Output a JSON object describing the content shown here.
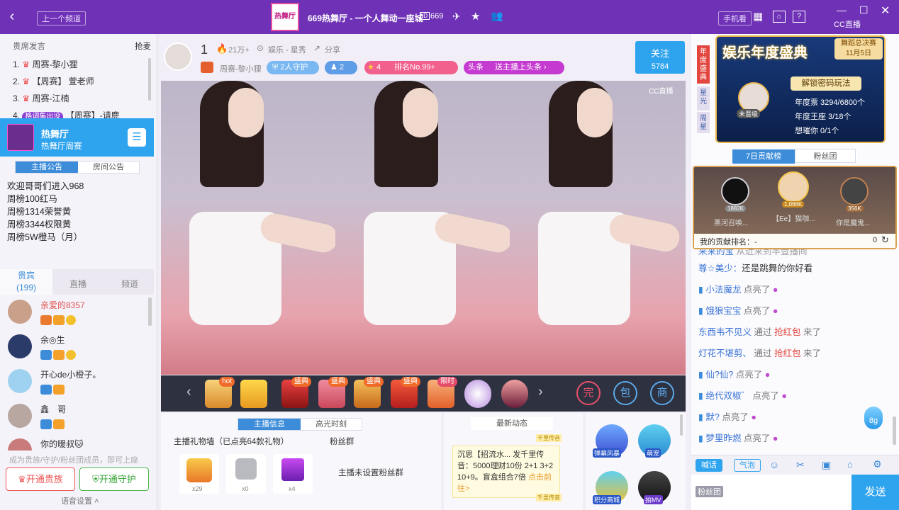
{
  "topbar": {
    "prev_channel": "上一个频道",
    "room_title": "669热舞厅 - 一个人舞动一座城",
    "room_id": "669",
    "phone_btn": "手机看",
    "help": "?",
    "cc_logo": "CC直播",
    "logo_text": "热舞厅"
  },
  "left": {
    "ranking_title": "贵席发言",
    "grab": "抢麦",
    "ranks": [
      {
        "num": "1.",
        "name": "周赛-黎小狸"
      },
      {
        "num": "2.",
        "name": "【周赛】 萱老师"
      },
      {
        "num": "3.",
        "name": "周赛-江楠"
      },
      {
        "num": "4.",
        "name": "【周赛】-请麂",
        "tag": "格调集出没"
      }
    ],
    "channel": {
      "name": "热舞厅",
      "sub": "热舞厅周赛"
    },
    "notice_tabs": [
      "主播公告",
      "房间公告"
    ],
    "notice_lines": [
      "欢迎哥哥们进入968",
      "周榜100红马",
      "周榜1314荣誉黄",
      "周榜3344权限黄",
      "周榜5W橙马（月）"
    ],
    "user_tabs": {
      "vip": "贵宾",
      "vip_count": "(199)",
      "live": "直播",
      "channel": "频道"
    },
    "users": [
      {
        "name": "亲爱的8357",
        "color": "#e0534f"
      },
      {
        "name": "余◎生",
        "color": "#333"
      },
      {
        "name": "开心de小橙子。",
        "color": "#333"
      },
      {
        "name": "鑫　哥",
        "color": "#333"
      },
      {
        "name": "你的暖叔🐱",
        "color": "#333"
      }
    ],
    "upgrade_hint": "成为贵族/守护/粉丝团成员，即可上座",
    "btn_noble": "开通贵族",
    "btn_guard": "开通守护",
    "voice_settings": "语音设置"
  },
  "anchor": {
    "level": "1",
    "heat": "21万+",
    "category": "娱乐 - 星秀",
    "share": "分享",
    "nick": "周赛-黎小狸",
    "guard": "2人守护",
    "fans": "2",
    "stars": "4",
    "rank": "排名No.99+",
    "headline": "头条",
    "headline_link": "送主播上头条",
    "follow": "关注",
    "follow_count": "5784",
    "watermark": "CC直播"
  },
  "gifts": {
    "labels": [
      "hot",
      "盛典",
      "盛典",
      "盛典",
      "盛典",
      "盛典",
      "限时"
    ],
    "ops": [
      "完",
      "包",
      "商"
    ]
  },
  "bottom": {
    "tabs": [
      "主播信息",
      "高光时刻"
    ],
    "wall": "主播礼物墙（已点亮64款礼物）",
    "fans_group": "粉丝群",
    "no_fans_group": "主播未设置粉丝群",
    "gift_counts": [
      "x29",
      "x0",
      "x4"
    ],
    "news_title": "最新动态",
    "news_text": "沉思【招流水... 发千里传音：5000理财10份 2+1 3+2 10+9。盲盒组合7倍",
    "news_link": "点击前往>",
    "tag_top": "千里传音",
    "tag_bottom": "千里传音",
    "apps": [
      "弹幕风暴",
      "萌宠",
      "积分商城",
      "拍MV"
    ]
  },
  "right": {
    "side_tabs": [
      "年度盛典",
      "星光",
      "周星"
    ],
    "banner_title": "娱乐年度盛典",
    "finals": "舞蹈总决赛",
    "date": "11月5日",
    "unlock": "解锁密码玩法",
    "avatar_label": "未晋级",
    "votes": "年度票 3294/6800个",
    "king": "年度王座 3/18个",
    "miss": "想璀你 0/1个",
    "contrib_tabs": [
      "7日贡献榜",
      "粉丝团"
    ],
    "top3": [
      {
        "val": "1882K",
        "name": "黑河召唤..."
      },
      {
        "val": "1,066K",
        "name": "【Ee】猫咖..."
      },
      {
        "val": "356K",
        "name": "你是魔鬼..."
      }
    ],
    "my_rank": "我的贡献排名：-",
    "my_val": "0",
    "chat": [
      {
        "name": "来来的宝",
        "text": "从近来到半壹播间"
      },
      {
        "name": "尊☆美少：",
        "text": "还是跳舞的你好看"
      },
      {
        "name": "小法魔龙",
        "text": "点亮了"
      },
      {
        "name": "饿狼宝宝",
        "text": "点亮了"
      },
      {
        "name": "东西韦不见义",
        "pre": "通过",
        "mid": "抢红包",
        "text": "来了"
      },
      {
        "name": "灯花不堪剪、",
        "pre": "通过",
        "mid": "抢红包",
        "text": "来了"
      },
      {
        "name": "仙?仙?",
        "text": "点亮了"
      },
      {
        "name": "绝代双椒゛",
        "text": "点亮了"
      },
      {
        "name": "默?",
        "text": "点亮了"
      },
      {
        "name": "梦里昨燃",
        "text": "点亮了"
      }
    ],
    "float_badge": "8g",
    "tools": [
      "喊话",
      "气泡"
    ],
    "fans_tag": "粉丝团",
    "send": "发送"
  },
  "colors": {
    "topbar": "#6f32b6",
    "accent": "#2ea3ee",
    "pink": "#e33d8a",
    "red": "#e3463e"
  }
}
